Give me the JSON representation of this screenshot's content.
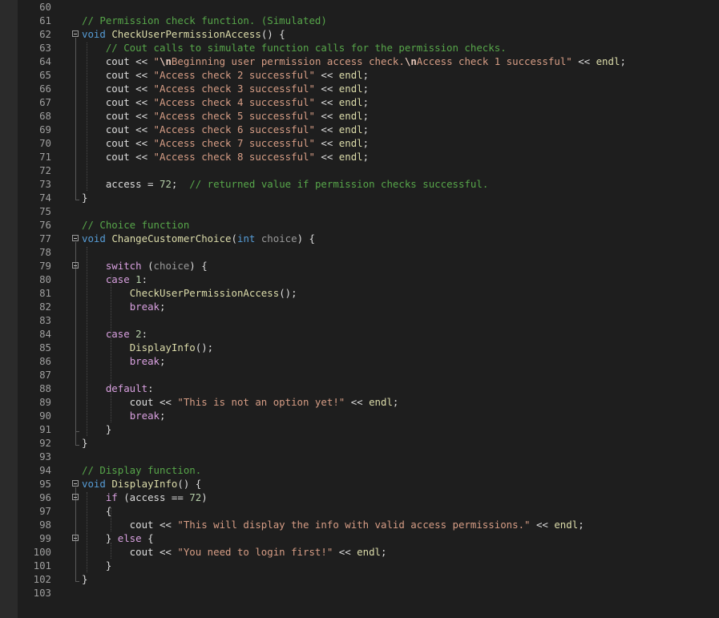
{
  "editor": {
    "lines": [
      {
        "n": "60",
        "tokens": []
      },
      {
        "n": "61",
        "tokens": [
          {
            "t": "cm",
            "v": "// Permission check function. (Simulated)"
          }
        ]
      },
      {
        "n": "62",
        "fold": true,
        "tokens": [
          {
            "t": "kw",
            "v": "void"
          },
          {
            "t": "p",
            "v": " "
          },
          {
            "t": "fn",
            "v": "CheckUserPermissionAccess"
          },
          {
            "t": "p",
            "v": "() {"
          }
        ]
      },
      {
        "n": "63",
        "tokens": [
          {
            "t": "p",
            "v": "    "
          },
          {
            "t": "cm",
            "v": "// Cout calls to simulate function calls for the permission checks."
          }
        ]
      },
      {
        "n": "64",
        "tokens": [
          {
            "t": "p",
            "v": "    cout << "
          },
          {
            "t": "str",
            "v": "\""
          },
          {
            "t": "esc",
            "v": "\\n"
          },
          {
            "t": "str",
            "v": "Beginning user permission access check."
          },
          {
            "t": "esc",
            "v": "\\n"
          },
          {
            "t": "str",
            "v": "Access check 1 successful\""
          },
          {
            "t": "p",
            "v": " << "
          },
          {
            "t": "fn",
            "v": "endl"
          },
          {
            "t": "p",
            "v": ";"
          }
        ]
      },
      {
        "n": "65",
        "tokens": [
          {
            "t": "p",
            "v": "    cout << "
          },
          {
            "t": "str",
            "v": "\"Access check 2 successful\""
          },
          {
            "t": "p",
            "v": " << "
          },
          {
            "t": "fn",
            "v": "endl"
          },
          {
            "t": "p",
            "v": ";"
          }
        ]
      },
      {
        "n": "66",
        "tokens": [
          {
            "t": "p",
            "v": "    cout << "
          },
          {
            "t": "str",
            "v": "\"Access check 3 successful\""
          },
          {
            "t": "p",
            "v": " << "
          },
          {
            "t": "fn",
            "v": "endl"
          },
          {
            "t": "p",
            "v": ";"
          }
        ]
      },
      {
        "n": "67",
        "tokens": [
          {
            "t": "p",
            "v": "    cout << "
          },
          {
            "t": "str",
            "v": "\"Access check 4 successful\""
          },
          {
            "t": "p",
            "v": " << "
          },
          {
            "t": "fn",
            "v": "endl"
          },
          {
            "t": "p",
            "v": ";"
          }
        ]
      },
      {
        "n": "68",
        "tokens": [
          {
            "t": "p",
            "v": "    cout << "
          },
          {
            "t": "str",
            "v": "\"Access check 5 successful\""
          },
          {
            "t": "p",
            "v": " << "
          },
          {
            "t": "fn",
            "v": "endl"
          },
          {
            "t": "p",
            "v": ";"
          }
        ]
      },
      {
        "n": "69",
        "tokens": [
          {
            "t": "p",
            "v": "    cout << "
          },
          {
            "t": "str",
            "v": "\"Access check 6 successful\""
          },
          {
            "t": "p",
            "v": " << "
          },
          {
            "t": "fn",
            "v": "endl"
          },
          {
            "t": "p",
            "v": ";"
          }
        ]
      },
      {
        "n": "70",
        "tokens": [
          {
            "t": "p",
            "v": "    cout << "
          },
          {
            "t": "str",
            "v": "\"Access check 7 successful\""
          },
          {
            "t": "p",
            "v": " << "
          },
          {
            "t": "fn",
            "v": "endl"
          },
          {
            "t": "p",
            "v": ";"
          }
        ]
      },
      {
        "n": "71",
        "tokens": [
          {
            "t": "p",
            "v": "    cout << "
          },
          {
            "t": "str",
            "v": "\"Access check 8 successful\""
          },
          {
            "t": "p",
            "v": " << "
          },
          {
            "t": "fn",
            "v": "endl"
          },
          {
            "t": "p",
            "v": ";"
          }
        ]
      },
      {
        "n": "72",
        "tokens": []
      },
      {
        "n": "73",
        "tokens": [
          {
            "t": "p",
            "v": "    access = "
          },
          {
            "t": "num",
            "v": "72"
          },
          {
            "t": "p",
            "v": ";  "
          },
          {
            "t": "cm",
            "v": "// returned value if permission checks successful."
          }
        ]
      },
      {
        "n": "74",
        "tokens": [
          {
            "t": "p",
            "v": "}"
          }
        ]
      },
      {
        "n": "75",
        "tokens": []
      },
      {
        "n": "76",
        "tokens": [
          {
            "t": "cm",
            "v": "// Choice function"
          }
        ]
      },
      {
        "n": "77",
        "fold": true,
        "tokens": [
          {
            "t": "kw",
            "v": "void"
          },
          {
            "t": "p",
            "v": " "
          },
          {
            "t": "fn",
            "v": "ChangeCustomerChoice"
          },
          {
            "t": "p",
            "v": "("
          },
          {
            "t": "kw",
            "v": "int"
          },
          {
            "t": "p",
            "v": " "
          },
          {
            "t": "param",
            "v": "choice"
          },
          {
            "t": "p",
            "v": ") {"
          }
        ]
      },
      {
        "n": "78",
        "tokens": []
      },
      {
        "n": "79",
        "fold": true,
        "tokens": [
          {
            "t": "p",
            "v": "    "
          },
          {
            "t": "ctl",
            "v": "switch"
          },
          {
            "t": "p",
            "v": " ("
          },
          {
            "t": "param",
            "v": "choice"
          },
          {
            "t": "p",
            "v": ") {"
          }
        ]
      },
      {
        "n": "80",
        "tokens": [
          {
            "t": "p",
            "v": "    "
          },
          {
            "t": "ctl",
            "v": "case"
          },
          {
            "t": "p",
            "v": " "
          },
          {
            "t": "num",
            "v": "1"
          },
          {
            "t": "p",
            "v": ":"
          }
        ]
      },
      {
        "n": "81",
        "tokens": [
          {
            "t": "p",
            "v": "        "
          },
          {
            "t": "fn",
            "v": "CheckUserPermissionAccess"
          },
          {
            "t": "p",
            "v": "();"
          }
        ]
      },
      {
        "n": "82",
        "tokens": [
          {
            "t": "p",
            "v": "        "
          },
          {
            "t": "ctl",
            "v": "break"
          },
          {
            "t": "p",
            "v": ";"
          }
        ]
      },
      {
        "n": "83",
        "tokens": []
      },
      {
        "n": "84",
        "tokens": [
          {
            "t": "p",
            "v": "    "
          },
          {
            "t": "ctl",
            "v": "case"
          },
          {
            "t": "p",
            "v": " "
          },
          {
            "t": "num",
            "v": "2"
          },
          {
            "t": "p",
            "v": ":"
          }
        ]
      },
      {
        "n": "85",
        "tokens": [
          {
            "t": "p",
            "v": "        "
          },
          {
            "t": "fn",
            "v": "DisplayInfo"
          },
          {
            "t": "p",
            "v": "();"
          }
        ]
      },
      {
        "n": "86",
        "tokens": [
          {
            "t": "p",
            "v": "        "
          },
          {
            "t": "ctl",
            "v": "break"
          },
          {
            "t": "p",
            "v": ";"
          }
        ]
      },
      {
        "n": "87",
        "tokens": []
      },
      {
        "n": "88",
        "tokens": [
          {
            "t": "p",
            "v": "    "
          },
          {
            "t": "ctl",
            "v": "default"
          },
          {
            "t": "p",
            "v": ":"
          }
        ]
      },
      {
        "n": "89",
        "tokens": [
          {
            "t": "p",
            "v": "        cout << "
          },
          {
            "t": "str",
            "v": "\"This is not an option yet!\""
          },
          {
            "t": "p",
            "v": " << "
          },
          {
            "t": "fn",
            "v": "endl"
          },
          {
            "t": "p",
            "v": ";"
          }
        ]
      },
      {
        "n": "90",
        "tokens": [
          {
            "t": "p",
            "v": "        "
          },
          {
            "t": "ctl",
            "v": "break"
          },
          {
            "t": "p",
            "v": ";"
          }
        ]
      },
      {
        "n": "91",
        "tokens": [
          {
            "t": "p",
            "v": "    }"
          }
        ]
      },
      {
        "n": "92",
        "tokens": [
          {
            "t": "p",
            "v": "}"
          }
        ]
      },
      {
        "n": "93",
        "tokens": []
      },
      {
        "n": "94",
        "tokens": [
          {
            "t": "cm",
            "v": "// Display function."
          }
        ]
      },
      {
        "n": "95",
        "fold": true,
        "tokens": [
          {
            "t": "kw",
            "v": "void"
          },
          {
            "t": "p",
            "v": " "
          },
          {
            "t": "fn",
            "v": "DisplayInfo"
          },
          {
            "t": "p",
            "v": "() {"
          }
        ]
      },
      {
        "n": "96",
        "fold": true,
        "tokens": [
          {
            "t": "p",
            "v": "    "
          },
          {
            "t": "ctl",
            "v": "if"
          },
          {
            "t": "p",
            "v": " (access == "
          },
          {
            "t": "num",
            "v": "72"
          },
          {
            "t": "p",
            "v": ")"
          }
        ]
      },
      {
        "n": "97",
        "tokens": [
          {
            "t": "p",
            "v": "    {"
          }
        ]
      },
      {
        "n": "98",
        "tokens": [
          {
            "t": "p",
            "v": "        cout << "
          },
          {
            "t": "str",
            "v": "\"This will display the info with valid access permissions.\""
          },
          {
            "t": "p",
            "v": " << "
          },
          {
            "t": "fn",
            "v": "endl"
          },
          {
            "t": "p",
            "v": ";"
          }
        ]
      },
      {
        "n": "99",
        "fold": true,
        "tokens": [
          {
            "t": "p",
            "v": "    } "
          },
          {
            "t": "ctl",
            "v": "else"
          },
          {
            "t": "p",
            "v": " {"
          }
        ]
      },
      {
        "n": "100",
        "tokens": [
          {
            "t": "p",
            "v": "        cout << "
          },
          {
            "t": "str",
            "v": "\"You need to login first!\""
          },
          {
            "t": "p",
            "v": " << "
          },
          {
            "t": "fn",
            "v": "endl"
          },
          {
            "t": "p",
            "v": ";"
          }
        ]
      },
      {
        "n": "101",
        "tokens": [
          {
            "t": "p",
            "v": "    }"
          }
        ]
      },
      {
        "n": "102",
        "tokens": [
          {
            "t": "p",
            "v": "}"
          }
        ]
      },
      {
        "n": "103",
        "tokens": []
      }
    ]
  }
}
